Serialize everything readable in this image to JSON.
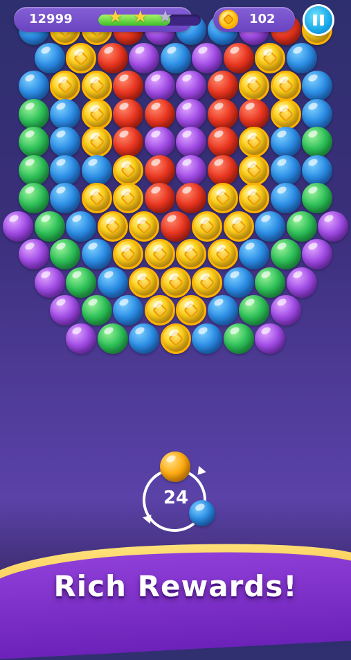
{
  "hud": {
    "score": "12999",
    "progress": 0.7,
    "stars": [
      "filled",
      "filled",
      "empty"
    ],
    "coins": "102",
    "pause_icon": "pause-icon"
  },
  "colors": {
    "blue": "#2d8fe6",
    "red": "#ea3620",
    "purple": "#a24de6",
    "green": "#2fc25a",
    "coin": "#ffd21c",
    "orange": "#ffac12",
    "banner": "#7a2fc8",
    "banner_trim": "#f6c13a"
  },
  "board": {
    "rows": [
      "BCCRPBBPRC",
      "BCRPBPRCB",
      "BCCRPPRCCB",
      "GBCRRPRRCB",
      "GBCRPPRCBG",
      "GBBCRPRCBB",
      "GBCCRRCCBG",
      "PGBCCRCCBGP",
      "PGBCCCCBGP",
      "PGBCCCBGP",
      "PGBCCBGP",
      "PGBCBGP"
    ]
  },
  "shooter": {
    "shots_left": "24",
    "current_color": "orange",
    "next_color": "blue"
  },
  "banner": {
    "text": "Rich Rewards!"
  }
}
